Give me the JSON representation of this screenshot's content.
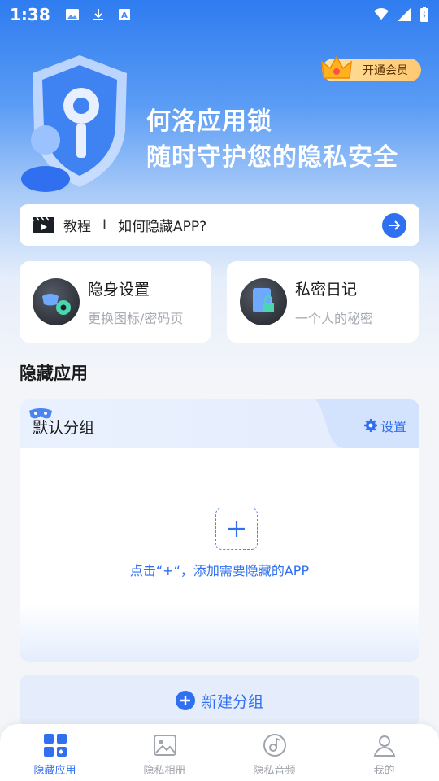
{
  "status_bar": {
    "time": "1:38"
  },
  "vip": {
    "label": "开通会员"
  },
  "hero": {
    "line1": "何洛应用锁",
    "line2": "随时守护您的隐私安全"
  },
  "tutorial": {
    "tag": "教程",
    "separator": "I",
    "text": "如何隐藏APP?"
  },
  "features": [
    {
      "title": "隐身设置",
      "subtitle": "更换图标/密码页",
      "icon": "mask-gear-icon"
    },
    {
      "title": "私密日记",
      "subtitle": "一个人的秘密",
      "icon": "locked-notebook-icon"
    }
  ],
  "section": {
    "title": "隐藏应用"
  },
  "group": {
    "name": "默认分组",
    "settings_label": "设置",
    "empty_hint": "点击“+“，添加需要隐藏的APP"
  },
  "new_group": {
    "label": "新建分组"
  },
  "bottom_nav": [
    {
      "label": "隐藏应用",
      "icon": "apps-grid-icon",
      "active": true
    },
    {
      "label": "隐私相册",
      "icon": "image-icon",
      "active": false
    },
    {
      "label": "隐私音频",
      "icon": "music-disc-icon",
      "active": false
    },
    {
      "label": "我的",
      "icon": "profile-icon",
      "active": false
    }
  ],
  "colors": {
    "accent": "#2f6ff0",
    "hero_top": "#2f7cf0",
    "vip": "#ffc871"
  }
}
